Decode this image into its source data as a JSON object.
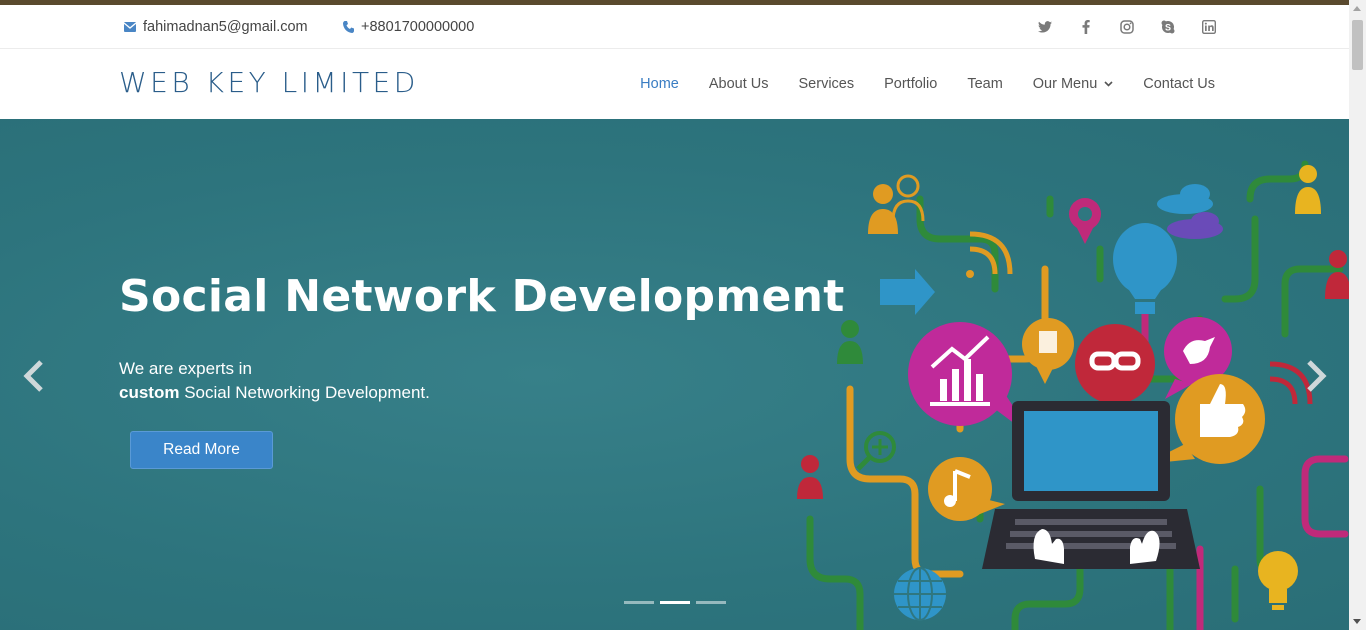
{
  "topbar": {
    "email": "fahimadnan5@gmail.com",
    "phone": "+8801700000000",
    "socials": [
      "twitter-icon",
      "facebook-icon",
      "instagram-icon",
      "skype-icon",
      "linkedin-icon"
    ]
  },
  "brand": {
    "name": "WEB KEY LIMITED",
    "color": "#2a5d8a"
  },
  "nav": {
    "items": [
      {
        "label": "Home",
        "active": true
      },
      {
        "label": "About Us"
      },
      {
        "label": "Services"
      },
      {
        "label": "Portfolio"
      },
      {
        "label": "Team"
      },
      {
        "label": "Our Menu",
        "dropdown": true
      },
      {
        "label": "Contact Us"
      }
    ],
    "active_color": "#3a7dc3"
  },
  "hero": {
    "title": "Social Network Development",
    "line1": "We are experts in",
    "line2_bold": "custom",
    "line2_rest": " Social Networking Development.",
    "button": "Read More",
    "background": "#2f7780",
    "slide_count": 3,
    "active_slide": 2
  },
  "colors": {
    "button": "#3a85c9"
  }
}
